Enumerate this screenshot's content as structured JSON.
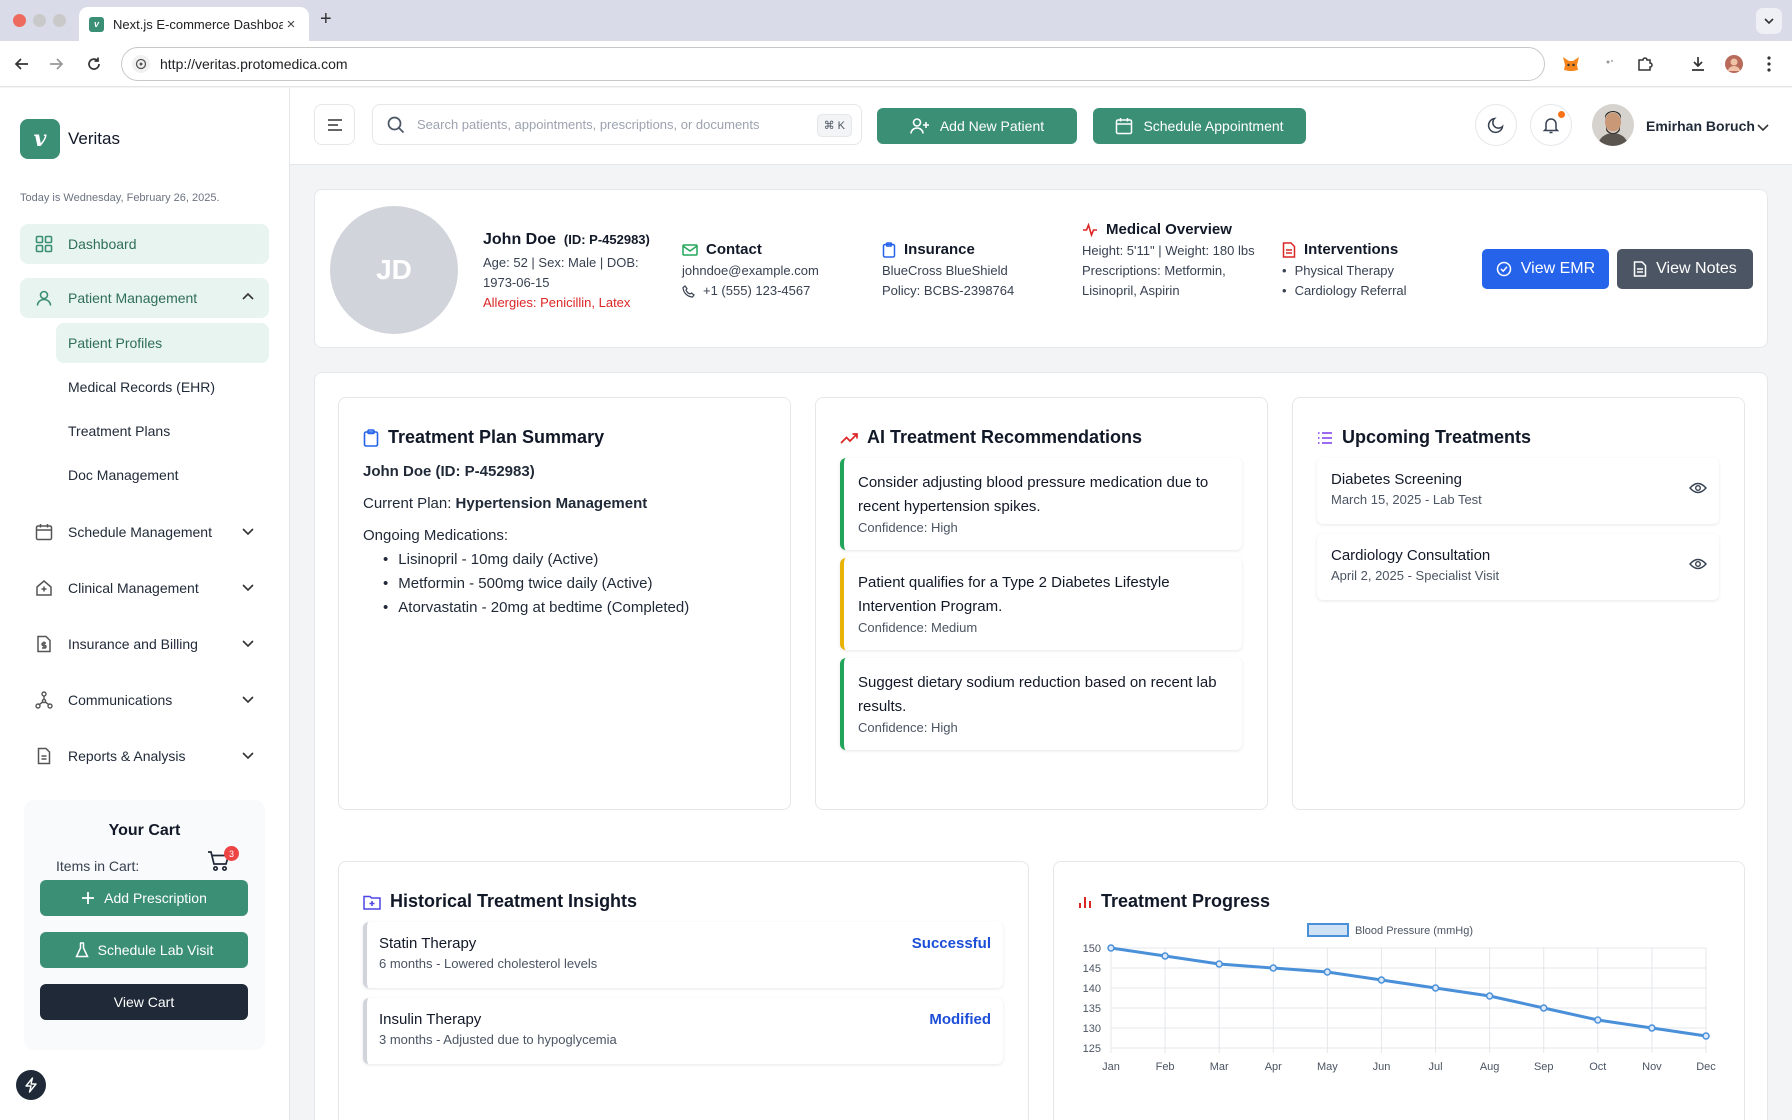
{
  "browser": {
    "tab_title": "Next.js E-commerce Dashboard",
    "tab_favicon_letter": "v",
    "url": "http://veritas.protomedica.com"
  },
  "sidebar": {
    "logo_letter": "v",
    "brand": "Veritas",
    "today": "Today is Wednesday, February 26, 2025.",
    "dashboard": "Dashboard",
    "patient_management": "Patient Management",
    "sub_items": [
      "Patient Profiles",
      "Medical Records (EHR)",
      "Treatment Plans",
      "Doc Management"
    ],
    "schedule_management": "Schedule Management",
    "clinical_management": "Clinical Management",
    "insurance_billing": "Insurance and Billing",
    "communications": "Communications",
    "reports": "Reports & Analysis"
  },
  "cart": {
    "title": "Your Cart",
    "items_label": "Items in Cart:",
    "count": "3",
    "add_prescription": "Add Prescription",
    "schedule_lab": "Schedule Lab Visit",
    "view_cart": "View Cart"
  },
  "header": {
    "search_placeholder": "Search patients, appointments, prescriptions, or documents",
    "shortcut": "⌘ K",
    "add_patient": "Add New Patient",
    "schedule_appointment": "Schedule Appointment",
    "user_name": "Emirhan Boruch"
  },
  "patient": {
    "initials": "JD",
    "name": "John Doe",
    "id": "(ID: P-452983)",
    "demographics": "Age: 52 | Sex: Male | DOB: 1973-06-15",
    "allergies": "Allergies: Penicillin, Latex",
    "contact_title": "Contact",
    "email": "johndoe@example.com",
    "phone": "+1 (555) 123-4567",
    "insurance_title": "Insurance",
    "insurer": "BlueCross BlueShield",
    "policy": "Policy: BCBS-2398764",
    "overview_title": "Medical Overview",
    "height_weight": "Height: 5'11\" | Weight: 180 lbs",
    "prescriptions": "Prescriptions: Metformin, Lisinopril, Aspirin",
    "interventions_title": "Interventions",
    "interventions": [
      "Physical Therapy",
      "Cardiology Referral"
    ],
    "view_emr": "View EMR",
    "view_notes": "View Notes"
  },
  "treatment_plan": {
    "title": "Treatment Plan Summary",
    "patient": "John Doe (ID: P-452983)",
    "plan_label": "Current Plan:",
    "plan": "Hypertension Management",
    "meds_label": "Ongoing Medications:",
    "medications": [
      "Lisinopril - 10mg daily (Active)",
      "Metformin - 500mg twice daily (Active)",
      "Atorvastatin - 20mg at bedtime (Completed)"
    ]
  },
  "ai_recommendations": {
    "title": "AI Treatment Recommendations",
    "items": [
      {
        "text": "Consider adjusting blood pressure medication due to recent hypertension spikes.",
        "confidence": "Confidence: High",
        "color": "#22a55a"
      },
      {
        "text": "Patient qualifies for a Type 2 Diabetes Lifestyle Intervention Program.",
        "confidence": "Confidence: Medium",
        "color": "#eab308"
      },
      {
        "text": "Suggest dietary sodium reduction based on recent lab results.",
        "confidence": "Confidence: High",
        "color": "#22a55a"
      }
    ]
  },
  "upcoming": {
    "title": "Upcoming Treatments",
    "items": [
      {
        "title": "Diabetes Screening",
        "detail": "March 15, 2025 - Lab Test"
      },
      {
        "title": "Cardiology Consultation",
        "detail": "April 2, 2025 - Specialist Visit"
      }
    ]
  },
  "history": {
    "title": "Historical Treatment Insights",
    "items": [
      {
        "title": "Statin Therapy",
        "detail": "6 months - Lowered cholesterol levels",
        "status": "Successful"
      },
      {
        "title": "Insulin Therapy",
        "detail": "3 months - Adjusted due to hypoglycemia",
        "status": "Modified"
      }
    ]
  },
  "progress": {
    "title": "Treatment Progress"
  },
  "colors": {
    "brand": "#3b8f75",
    "emr_button": "#2563eb",
    "notes_button": "#4b5563",
    "line": "#4a90d9"
  },
  "chart_data": {
    "type": "line",
    "title": "",
    "xlabel": "",
    "ylabel": "",
    "categories": [
      "Jan",
      "Feb",
      "Mar",
      "Apr",
      "May",
      "Jun",
      "Jul",
      "Aug",
      "Sep",
      "Oct",
      "Nov",
      "Dec"
    ],
    "series": [
      {
        "name": "Blood Pressure (mmHg)",
        "values": [
          150,
          148,
          146,
          145,
          144,
          142,
          140,
          138,
          135,
          132,
          130,
          128
        ]
      }
    ],
    "ylim": [
      125,
      150
    ],
    "yticks": [
      150,
      145,
      140,
      135,
      130,
      125
    ],
    "grid": true,
    "legend": "top-center"
  }
}
